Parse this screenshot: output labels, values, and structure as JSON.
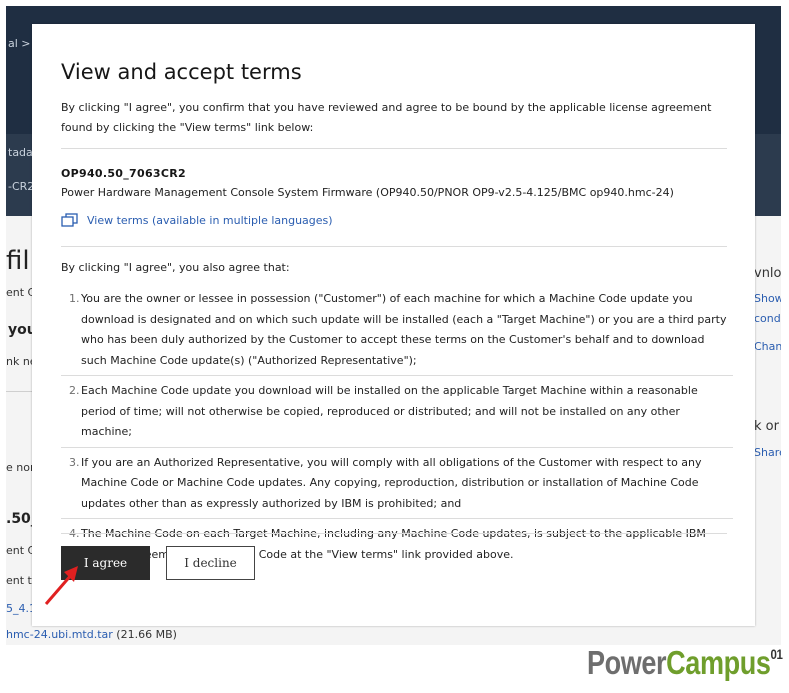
{
  "background": {
    "breadcrumb_fragment": "al",
    "breadcrumb_sep": ">",
    "meta_fragment": "tadat",
    "version_fragment": "-CR2",
    "heading_fragment": "fil",
    "sub_fragment": "ent C",
    "you_fragment": "you",
    "nk_fragment": "nk ne",
    "norm_fragment": "e norm",
    "fw_fragment": ".50_",
    "ent_fragment": "ent C",
    "ent_th_fragment": "ent th",
    "link_fragment": "5_4.1",
    "file_name": "hmc-24.ubi.mtd.tar",
    "file_size": "(21.66 MB)",
    "right_download": "vnlo",
    "right_show": "Show",
    "right_cond": "condi",
    "right_chan": "Chan",
    "right_ck": "k or",
    "right_share": "Share"
  },
  "modal": {
    "title": "View and accept terms",
    "intro": "By clicking \"I agree\", you confirm that you have reviewed and agree to be bound by the applicable license agreement found by clicking the \"View terms\" link below:",
    "firmware_id": "OP940.50_7063CR2",
    "firmware_desc": "Power Hardware Management Console System Firmware (OP940.50/PNOR OP9-v2.5-4.125/BMC op940.hmc-24)",
    "view_terms_label": "View terms (available in multiple languages)",
    "also_agree": "By clicking \"I agree\", you also agree that:",
    "terms": [
      {
        "num": "1.",
        "text": "You are the owner or lessee in possession (\"Customer\") of each machine for which a Machine Code update you download is designated and on which such update will be installed (each a \"Target Machine\") or you are a third party who has been duly authorized by the Customer to accept these terms on the Customer's behalf and to download such Machine Code update(s) (\"Authorized Representative\");"
      },
      {
        "num": "2.",
        "text": "Each Machine Code update you download will be installed on the applicable Target Machine within a reasonable period of time; will not otherwise be copied, reproduced or distributed; and will not be installed on any other machine;"
      },
      {
        "num": "3.",
        "text": "If you are an Authorized Representative, you will comply with all obligations of the Customer with respect to any Machine Code or Machine Code updates. Any copying, reproduction, distribution or installation of Machine Code updates other than as expressly authorized by IBM is prohibited; and"
      },
      {
        "num": "4.",
        "text": "The Machine Code on each Target Machine, including any Machine Code updates, is subject to the applicable IBM License Agreement for Machine Code at the \"View terms\" link provided above."
      }
    ],
    "agree_label": "I agree",
    "decline_label": "I decline"
  },
  "brand": {
    "part1": "Power",
    "part2": "Campus",
    "suffix": "01"
  },
  "colors": {
    "header_bg": "#1f2e42",
    "agree_bg": "#2b2b2b",
    "link": "#2a5db0",
    "arrow": "#e02020",
    "brand_green": "#6f9e2c"
  },
  "icons": [
    "copy-link-icon",
    "red-arrow-icon"
  ]
}
